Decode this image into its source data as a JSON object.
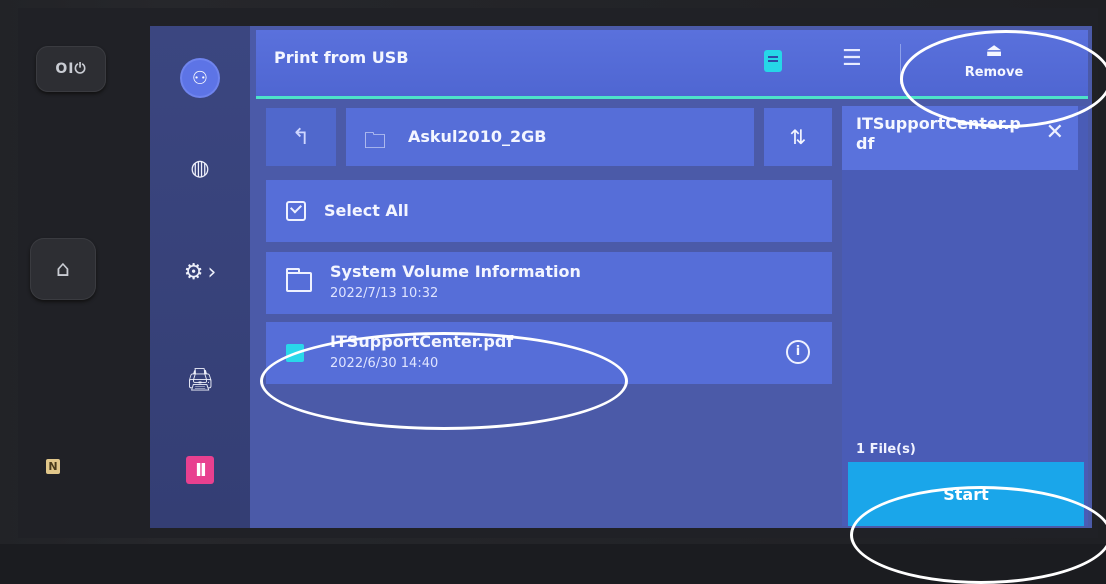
{
  "device": {
    "power_label": "ⅠⅠ∪",
    "home_icon": "home-icon"
  },
  "screen": {
    "title": "Print from USB",
    "remove_label": "Remove"
  },
  "navigator": {
    "current_folder": "Askul2010_2GB",
    "select_all_label": "Select All"
  },
  "files": [
    {
      "name": "System Volume Information",
      "date": "2022/7/13 10:32",
      "type": "folder"
    },
    {
      "name": "ITSupportCenter.pdf",
      "date": "2022/6/30 14:40",
      "type": "pdf"
    }
  ],
  "selection": {
    "filename": "ITSupportCenter.pdf",
    "count_label": "1 File(s)",
    "start_label": "Start"
  },
  "colors": {
    "accent_bar": "#4de3c9",
    "start_button": "#1aa6ea",
    "pause_button": "#e8408f"
  }
}
